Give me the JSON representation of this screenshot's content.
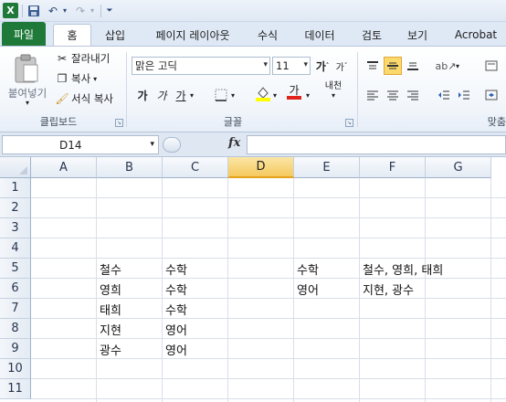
{
  "app_icon": "excel-logo",
  "quick_access": {
    "icons": [
      "save-icon",
      "undo-icon",
      "redo-icon",
      "customize-icon"
    ]
  },
  "tabs": [
    {
      "label": "파일"
    },
    {
      "label": "홈"
    },
    {
      "label": "삽입"
    },
    {
      "label": "페이지 레이아웃"
    },
    {
      "label": "수식"
    },
    {
      "label": "데이터"
    },
    {
      "label": "검토"
    },
    {
      "label": "보기"
    },
    {
      "label": "Acrobat"
    }
  ],
  "ribbon": {
    "clipboard": {
      "paste_label": "붙여넣기",
      "cut_label": "잘라내기",
      "copy_label": "복사",
      "format_painter_label": "서식 복사",
      "group_label": "클립보드"
    },
    "font": {
      "font_name": "맑은 고딕",
      "font_size": "11",
      "bold": "가",
      "italic": "가",
      "underline": "가",
      "font_color_glyph": "가",
      "phonetic": "내천",
      "group_label": "글꼴"
    },
    "alignment": {
      "group_label": "맞춤"
    }
  },
  "formula_bar": {
    "name_box": "D14",
    "fx": "fx",
    "formula": ""
  },
  "grid": {
    "columns": [
      "A",
      "B",
      "C",
      "D",
      "E",
      "F",
      "G"
    ],
    "selected_column": "D",
    "rows": [
      "1",
      "2",
      "3",
      "4",
      "5",
      "6",
      "7",
      "8",
      "9",
      "10",
      "11"
    ],
    "cells": {
      "B5": "철수",
      "C5": "수학",
      "E5": "수학",
      "F5": "철수, 영희, 태희",
      "B6": "영희",
      "C6": "수학",
      "E6": "영어",
      "F6": "지현, 광수",
      "B7": "태희",
      "C7": "수학",
      "B8": "지현",
      "C8": "영어",
      "B9": "광수",
      "C9": "영어"
    }
  }
}
